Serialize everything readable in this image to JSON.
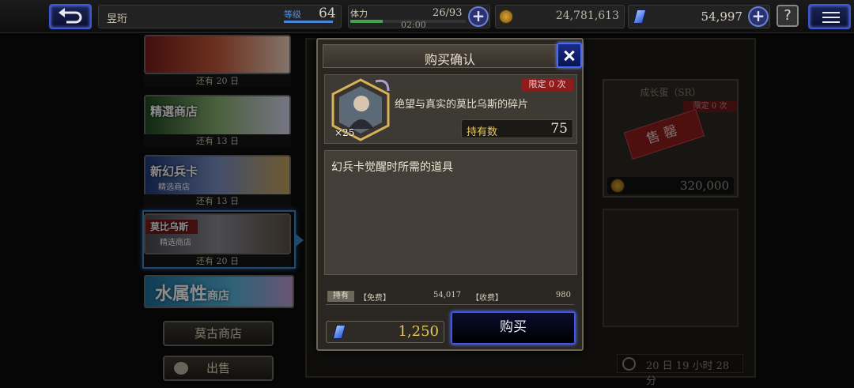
{
  "topbar": {
    "player_name": "昱珩",
    "level_label": "等级",
    "level_value": "64",
    "stamina_label": "体力",
    "stamina_value": "26/93",
    "stamina_timer": "02:00",
    "gil_value": "24,781,613",
    "gem_value": "54,997",
    "help_label": "?"
  },
  "shops": [
    {
      "remain": "还有 20 日"
    },
    {
      "title": "精選商店",
      "remain": "还有 13 日"
    },
    {
      "title": "新幻兵卡",
      "subtitle": "精选商店",
      "remain": "还有 13 日"
    },
    {
      "title": "莫比乌斯",
      "subtitle": "精选商店",
      "remain": "还有 20 日"
    },
    {
      "title": "水属性",
      "suffix": "商店"
    }
  ],
  "side_buttons": {
    "moogle": "莫古商店",
    "sell": "出售"
  },
  "background": {
    "card_title": "成长蛋（SR）",
    "card_limit": "限定 0 次",
    "soldout": "售罄",
    "card_price": "320,000",
    "timer": "20 日 19 小时 28 分"
  },
  "dialog": {
    "title": "购买确认",
    "item_count": "×25",
    "limit": "限定 0 次",
    "item_name": "绝望与真实的莫比乌斯的碎片",
    "owned_label": "持有数",
    "owned_value": "75",
    "description": "幻兵卡觉醒时所需的道具",
    "holdings_tag": "持有",
    "free_label": "【免费】",
    "free_value": "54,017",
    "paid_label": "【收费】",
    "paid_value": "980",
    "price": "1,250",
    "buy_label": "购买"
  },
  "colors": {
    "accent_blue": "#3c56e6",
    "gold": "#e6c75a",
    "limit_red": "#8e1c1c"
  },
  "icons": [
    "back-icon",
    "menu-icon",
    "gil-coin-icon",
    "gem-icon",
    "plus-icon",
    "help-icon",
    "close-icon",
    "clock-icon"
  ]
}
